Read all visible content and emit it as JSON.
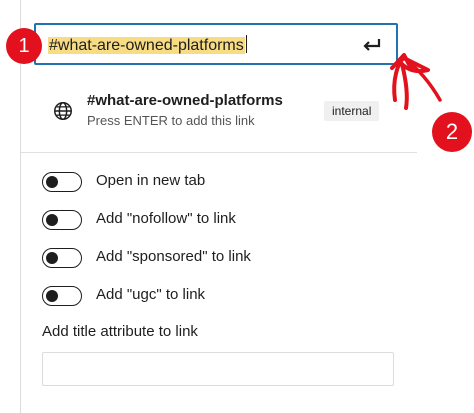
{
  "url_input": {
    "value": "#what-are-owned-platforms",
    "submit_icon": "enter-arrow-icon"
  },
  "suggestion": {
    "icon": "globe-icon",
    "title": "#what-are-owned-platforms",
    "subtitle": "Press ENTER to add this link",
    "badge": "internal"
  },
  "toggles": [
    {
      "label": "Open in new tab",
      "checked": false
    },
    {
      "label": "Add \"nofollow\" to link",
      "checked": false
    },
    {
      "label": "Add \"sponsored\" to link",
      "checked": false
    },
    {
      "label": "Add \"ugc\" to link",
      "checked": false
    }
  ],
  "title_attribute": {
    "label": "Add title attribute to link",
    "value": ""
  },
  "annotations": {
    "marker_1": "1",
    "marker_2": "2",
    "color": "#e3111d"
  },
  "colors": {
    "focus_border": "#2271b1",
    "highlight": "#f7dc84"
  }
}
